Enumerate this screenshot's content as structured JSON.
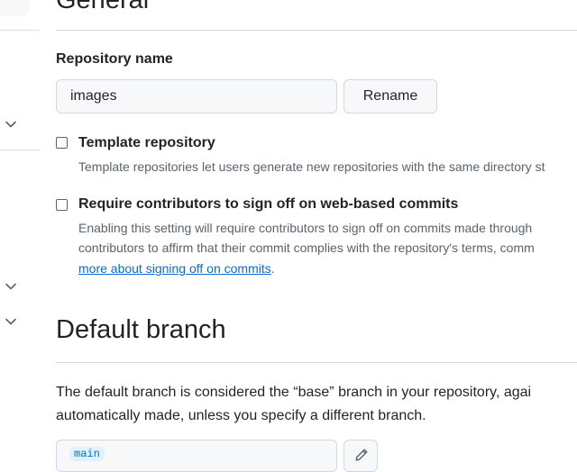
{
  "general": {
    "heading": "General",
    "repo_name_label": "Repository name",
    "repo_name_value": "images",
    "rename_label": "Rename",
    "template": {
      "title": "Template repository",
      "description": "Template repositories let users generate new repositories with the same directory st",
      "checked": false
    },
    "signoff": {
      "title": "Require contributors to sign off on web-based commits",
      "desc_line1": "Enabling this setting will require contributors to sign off on commits made through",
      "desc_line2": "contributors to affirm that their commit complies with the repository's terms, comm",
      "link_text": "more about signing off on commits",
      "after_link": ".",
      "checked": false
    }
  },
  "default_branch": {
    "heading": "Default branch",
    "line1": "The default branch is considered the “base” branch in your repository, agai",
    "line2": "automatically made, unless you specify a different branch.",
    "branch_name": "main"
  },
  "icons": [
    "chevron-down-icon",
    "pencil-icon"
  ],
  "colors": {
    "link": "#0969da",
    "muted": "#59636e",
    "border": "#d1d9e0",
    "field_bg": "#f6f8fa"
  }
}
